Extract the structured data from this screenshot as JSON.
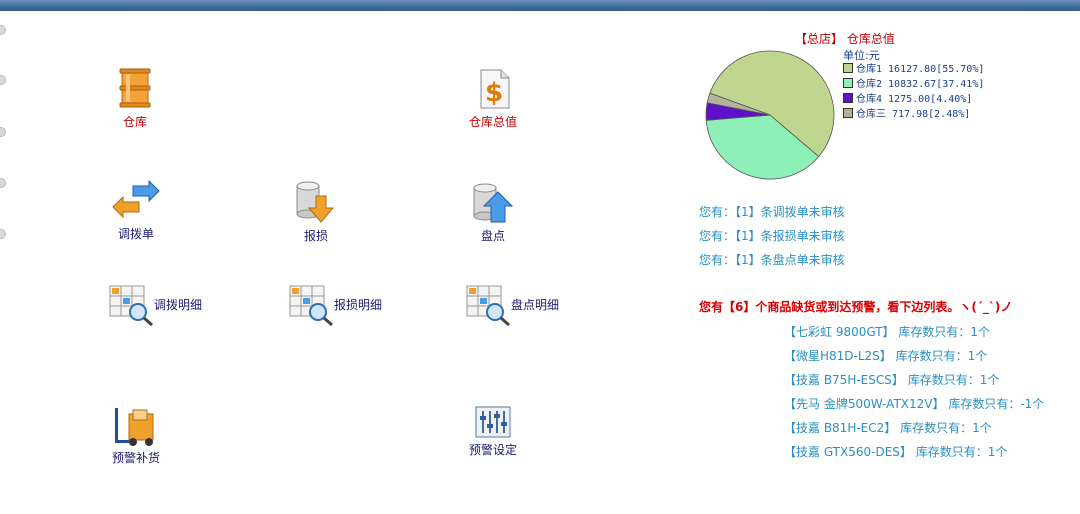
{
  "tiles": {
    "warehouse": "仓库",
    "warehouse_value": "仓库总值",
    "transfer": "调拨单",
    "loss": "报损",
    "stocktake": "盘点",
    "transfer_detail": "调拨明细",
    "loss_detail": "报损明细",
    "stocktake_detail": "盘点明细",
    "restock": "预警补货",
    "alert_settings": "预警设定"
  },
  "pie": {
    "title": "【总店】 仓库总值",
    "unit": "单位:元",
    "legend": [
      {
        "text": "仓库1 16127.80[55.70%]",
        "color": "#bfd68f"
      },
      {
        "text": "仓库2 10832.67[37.41%]",
        "color": "#8df0b8"
      },
      {
        "text": "仓库4 1275.00[4.40%]",
        "color": "#6010c8"
      },
      {
        "text": "仓库三 717.98[2.48%]",
        "color": "#b2b49a"
      }
    ]
  },
  "chart_data": {
    "type": "pie",
    "title": "【总店】 仓库总值",
    "unit": "单位:元",
    "categories": [
      "仓库1",
      "仓库2",
      "仓库4",
      "仓库三"
    ],
    "values": [
      16127.8,
      10832.67,
      1275.0,
      717.98
    ],
    "percents": [
      55.7,
      37.41,
      4.4,
      2.48
    ],
    "colors": [
      "#bfd68f",
      "#8df0b8",
      "#6010c8",
      "#b2b49a"
    ]
  },
  "notices": [
    "您有：【1】条调拨单未审核",
    "您有：【1】条报损单未审核",
    "您有：【1】条盘点单未审核"
  ],
  "alert": "您有【6】个商品缺货或到达预警，看下边列表。ヽ(´_`)ノ",
  "stock": [
    {
      "name": "【七彩虹 9800GT】",
      "qty": "库存数只有：1个"
    },
    {
      "name": "【微星H81D-L2S】",
      "qty": "库存数只有：1个"
    },
    {
      "name": "【技嘉 B75H-ESCS】",
      "qty": "库存数只有：1个"
    },
    {
      "name": "【先马 金牌500W-ATX12V】",
      "qty": "库存数只有：-1个"
    },
    {
      "name": "【技嘉 B81H-EC2】",
      "qty": "库存数只有：1个"
    },
    {
      "name": "【技嘉 GTX560-DES】",
      "qty": "库存数只有：1个"
    }
  ]
}
